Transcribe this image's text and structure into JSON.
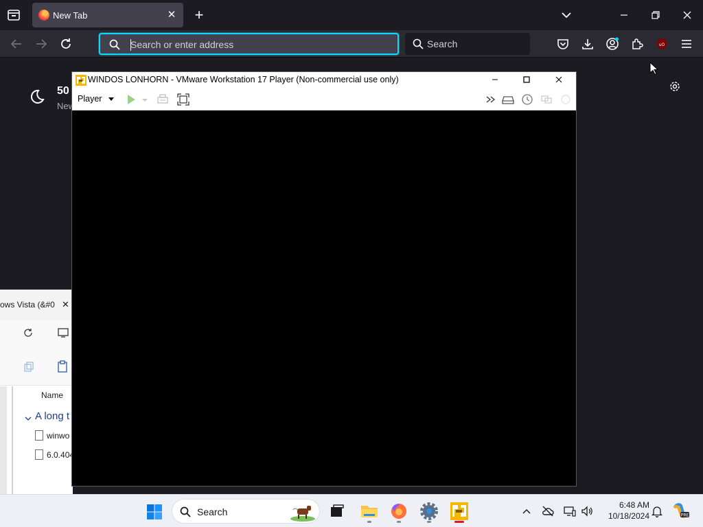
{
  "browser": {
    "tab_title": "New Tab",
    "url_placeholder": "Search or enter address",
    "search_placeholder": "Search"
  },
  "new_tab_page": {
    "number": "50",
    "subtitle": "New"
  },
  "explorer": {
    "tab_title": "ows Vista (&#0",
    "column_name": "Name",
    "group_label": "A long t",
    "files": [
      "winwo",
      "6.0.404"
    ]
  },
  "vmware": {
    "title": "WINDOS LONHORN - VMware Workstation 17 Player (Non-commercial use only)",
    "player_menu": "Player"
  },
  "taskbar": {
    "search_label": "Search",
    "time": "6:48 AM",
    "date": "10/18/2024"
  },
  "colors": {
    "urlbar_focus": "#00ddff",
    "ff_chrome": "#1c1b22",
    "ff_navbar": "#2b2a33",
    "taskbar_bg": "#eef0f6",
    "vm_screen": "#000000"
  }
}
